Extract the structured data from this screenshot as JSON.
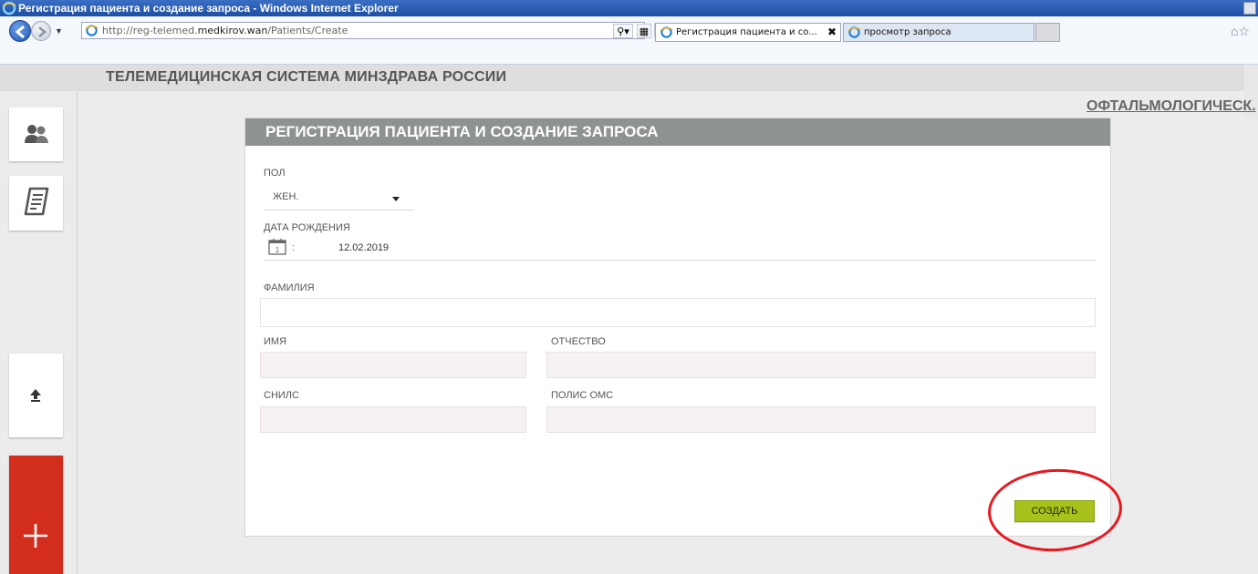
{
  "window": {
    "title": "Регистрация пациента и создание запроса - Windows Internet Explorer"
  },
  "browser": {
    "url_prefix": "http://reg-telemed.",
    "url_domain": "medkirov.wan",
    "url_path": "/Patients/Create",
    "tabs": [
      {
        "label": "Регистрация пациента и со...",
        "close": "✖"
      },
      {
        "label": "просмотр запроса"
      }
    ]
  },
  "site": {
    "title": "ТЕЛЕМЕДИЦИНСКАЯ СИСТЕМА МИНЗДРАВА РОССИИ",
    "top_link": "ОФТАЛЬМОЛОГИЧЕСК."
  },
  "form": {
    "title": "РЕГИСТРАЦИЯ ПАЦИЕНТА И СОЗДАНИЕ ЗАПРОСА",
    "gender_label": "ПОЛ",
    "gender_value": "ЖЕН.",
    "birth_label": "ДАТА РОЖДЕНИЯ",
    "birth_colon": ":",
    "birth_value": "12.02.2019",
    "lastname_label": "ФАМИЛИЯ",
    "firstname_label": "ИМЯ",
    "patronymic_label": "ОТЧЕСТВО",
    "snils_label": "СНИЛС",
    "oms_label": "ПОЛИС ОМС",
    "submit_label": "СОЗДАТЬ"
  },
  "colors": {
    "card_header": "#8f9293",
    "submit": "#a8c11d",
    "sidebar_plus": "#d22d1d",
    "annotation_ring": "#e8171f"
  },
  "icons": [
    "ie-icon",
    "back-icon",
    "forward-icon",
    "search-icon",
    "compat-icon",
    "refresh-icon",
    "stop-icon",
    "home-icon",
    "users-icon",
    "document-icon",
    "arrow-up-icon",
    "plus-icon",
    "calendar-icon"
  ]
}
